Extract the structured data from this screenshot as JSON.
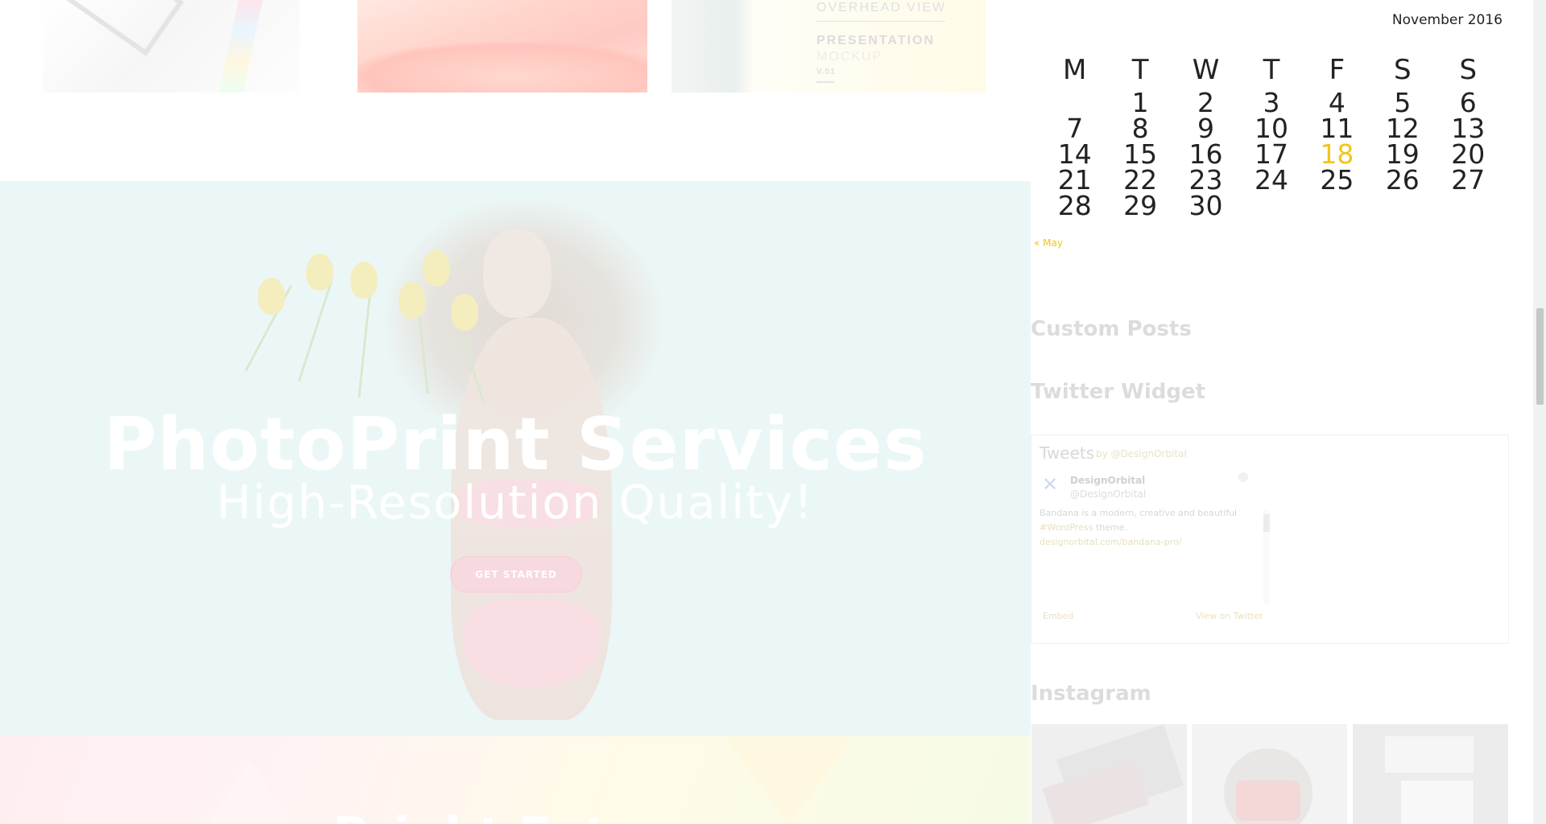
{
  "portfolio": {
    "overhead_view": "OVERHEAD VIEW",
    "presentation": "PRESENTATION",
    "mockup": "MOCKUP",
    "version": "V.01"
  },
  "hero": {
    "title": "PhotoPrint Services",
    "subtitle": "High-Resolution Quality!",
    "cta": "GET STARTED"
  },
  "bottom_band": {
    "title": "Bright Future"
  },
  "calendar": {
    "caption": "November 2016",
    "weekday_headers": [
      "M",
      "T",
      "W",
      "T",
      "F",
      "S",
      "S"
    ],
    "weeks": [
      [
        "",
        "1",
        "2",
        "3",
        "4",
        "5",
        "6"
      ],
      [
        "7",
        "8",
        "9",
        "10",
        "11",
        "12",
        "13"
      ],
      [
        "14",
        "15",
        "16",
        "17",
        "18",
        "19",
        "20"
      ],
      [
        "21",
        "22",
        "23",
        "24",
        "25",
        "26",
        "27"
      ],
      [
        "28",
        "29",
        "30",
        "",
        "",
        "",
        ""
      ]
    ],
    "today": "18",
    "prev_link": "« May"
  },
  "widgets": {
    "custom_posts": "Custom Posts",
    "twitter": "Twitter Widget",
    "instagram": "Instagram"
  },
  "twitter": {
    "title": "Tweets",
    "by": "by @DesignOrbital",
    "user_name": "DesignOrbital",
    "user_handle": "@DesignOrbital",
    "tweet_line1": "Bandana is a modern, creative and beautiful",
    "tweet_hashtag": "#WordPress",
    "tweet_after_hashtag": " theme.",
    "tweet_link": "designorbital.com/bandana-pro/",
    "embed": "Embed",
    "view_on": "View on Twitter"
  },
  "colors": {
    "accent": "#f2c51b",
    "hero_bg": "#ebf7f7",
    "text": "#222222"
  }
}
